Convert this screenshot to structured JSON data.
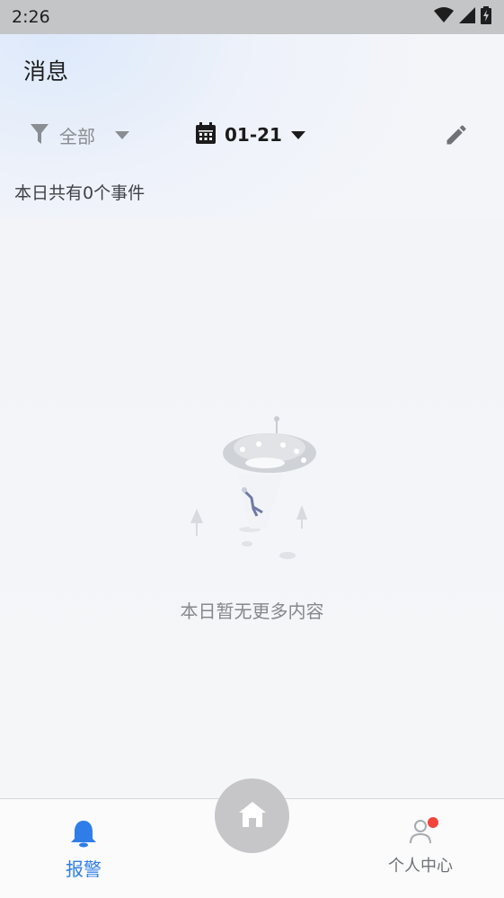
{
  "status_bar": {
    "time": "2:26",
    "icons": [
      "wifi-icon",
      "signal-icon",
      "battery-charging-icon"
    ]
  },
  "header": {
    "title": "消息"
  },
  "filter": {
    "label": "全部",
    "icon": "filter-icon",
    "dropdown_icon": "caret-down-icon"
  },
  "date_picker": {
    "value": "01-21",
    "icon": "calendar-icon",
    "dropdown_icon": "caret-down-icon"
  },
  "edit": {
    "icon": "pencil-icon"
  },
  "summary": {
    "text": "本日共有0个事件"
  },
  "empty_state": {
    "text": "本日暂无更多内容",
    "illustration": "ufo-illustration"
  },
  "bottom_nav": {
    "items": [
      {
        "label": "报警",
        "icon": "bell-icon",
        "active": true
      },
      {
        "label": "个人中心",
        "icon": "user-icon",
        "active": false,
        "has_badge": true
      }
    ],
    "home": {
      "icon": "home-icon"
    }
  },
  "colors": {
    "accent": "#2f7de9",
    "badge": "#f2443a",
    "status_bar": "#c4c5c7",
    "home_button": "#c6c6c8"
  }
}
